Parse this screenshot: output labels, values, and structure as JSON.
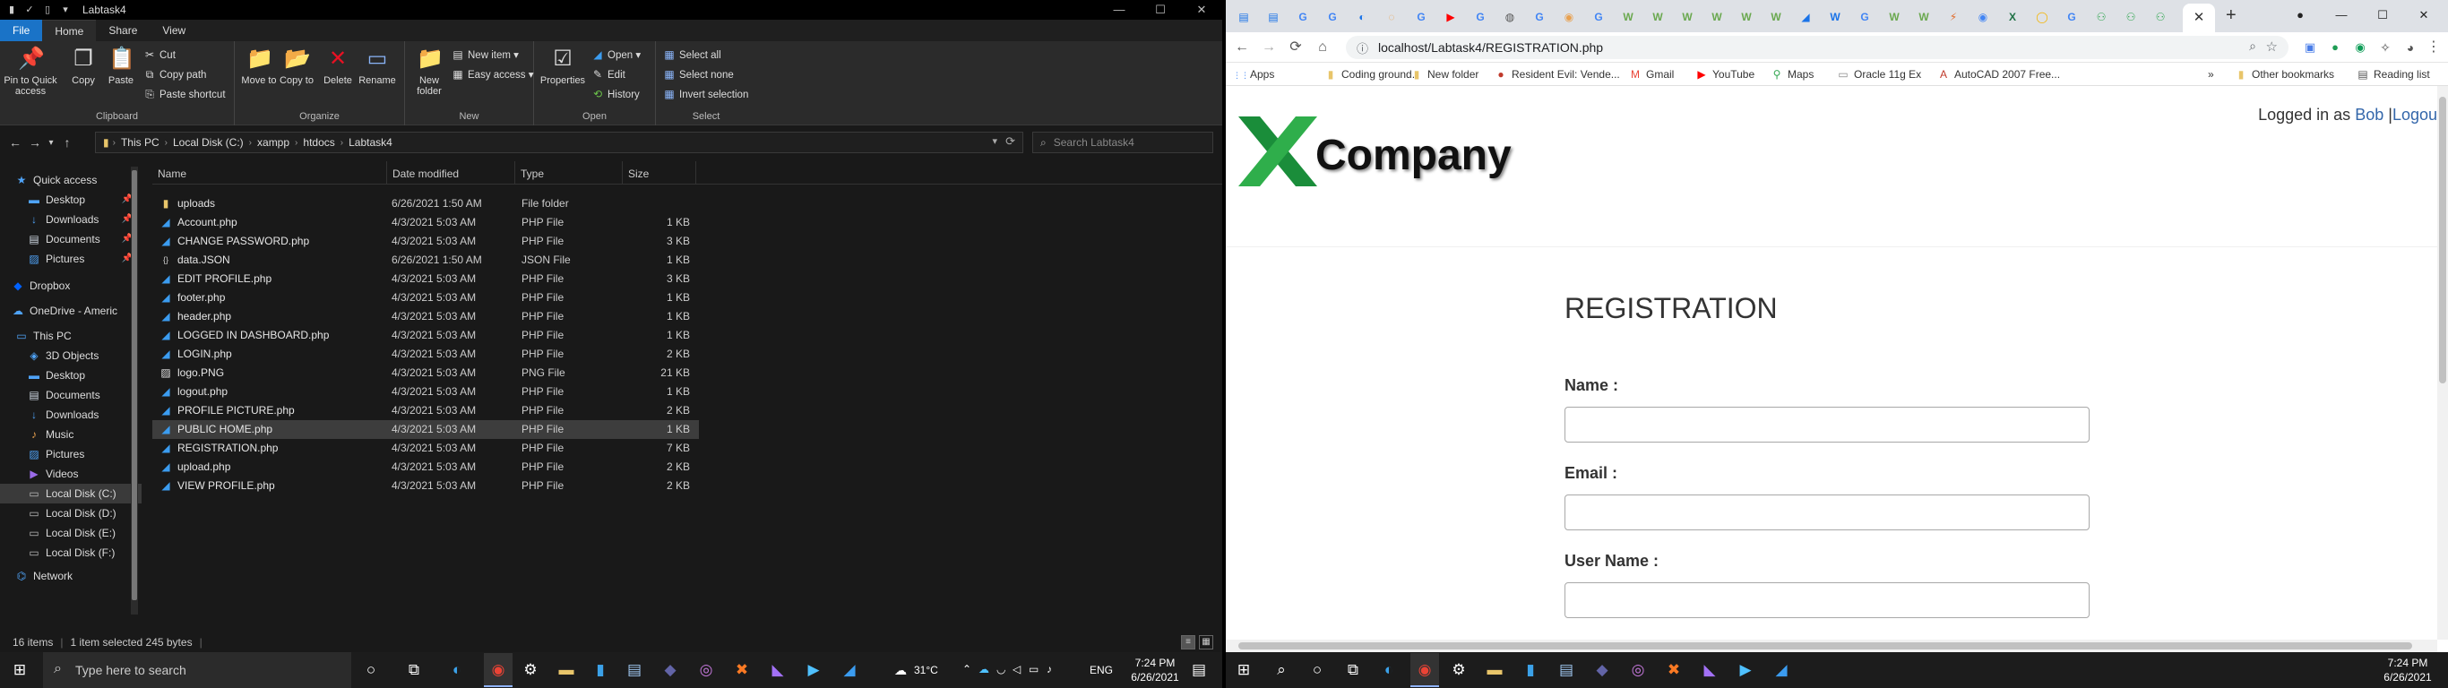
{
  "explorer": {
    "window_title": "Labtask4",
    "window_controls": [
      "—",
      "☐",
      "✕"
    ],
    "tabs": [
      {
        "label": "File"
      },
      {
        "label": "Home"
      },
      {
        "label": "Share"
      },
      {
        "label": "View"
      }
    ],
    "ribbon": {
      "clipboard": {
        "group_label": "Clipboard",
        "pin_label": "Pin to Quick access",
        "copy_label": "Copy",
        "paste_label": "Paste",
        "cut_label": "Cut",
        "copy_path_label": "Copy path",
        "paste_shortcut_label": "Paste shortcut"
      },
      "organize": {
        "group_label": "Organize",
        "move_to_label": "Move to",
        "copy_to_label": "Copy to",
        "delete_label": "Delete",
        "rename_label": "Rename"
      },
      "new": {
        "group_label": "New",
        "new_folder_label": "New folder",
        "new_item_label": "New item",
        "easy_access_label": "Easy access"
      },
      "open": {
        "group_label": "Open",
        "properties_label": "Properties",
        "open_label": "Open",
        "edit_label": "Edit",
        "history_label": "History"
      },
      "select": {
        "group_label": "Select",
        "select_all_label": "Select all",
        "select_none_label": "Select none",
        "invert_label": "Invert selection"
      }
    },
    "breadcrumb": [
      "This PC",
      "Local Disk (C:)",
      "xampp",
      "htdocs",
      "Labtask4"
    ],
    "search_placeholder": "Search Labtask4",
    "nav_items": [
      {
        "label": "Quick access",
        "icon": "star-icon",
        "pinned": false
      },
      {
        "label": "Desktop",
        "icon": "desktop-icon",
        "pinned": true
      },
      {
        "label": "Downloads",
        "icon": "download-icon",
        "pinned": true
      },
      {
        "label": "Documents",
        "icon": "document-icon",
        "pinned": true
      },
      {
        "label": "Pictures",
        "icon": "picture-icon",
        "pinned": true
      },
      {
        "label": "Dropbox",
        "icon": "dropbox-icon",
        "pinned": false
      },
      {
        "label": "OneDrive - Americ",
        "icon": "cloud-icon",
        "pinned": false
      },
      {
        "label": "This PC",
        "icon": "computer-icon",
        "pinned": false
      },
      {
        "label": "3D Objects",
        "icon": "cube-icon",
        "pinned": false
      },
      {
        "label": "Desktop",
        "icon": "desktop-icon",
        "pinned": false
      },
      {
        "label": "Documents",
        "icon": "document-icon",
        "pinned": false
      },
      {
        "label": "Downloads",
        "icon": "download-icon",
        "pinned": false
      },
      {
        "label": "Music",
        "icon": "music-icon",
        "pinned": false
      },
      {
        "label": "Pictures",
        "icon": "picture-icon",
        "pinned": false
      },
      {
        "label": "Videos",
        "icon": "video-icon",
        "pinned": false
      },
      {
        "label": "Local Disk (C:)",
        "icon": "drive-icon",
        "pinned": false
      },
      {
        "label": "Local Disk (D:)",
        "icon": "drive-icon",
        "pinned": false
      },
      {
        "label": "Local Disk (E:)",
        "icon": "drive-icon",
        "pinned": false
      },
      {
        "label": "Local Disk (F:)",
        "icon": "drive-icon",
        "pinned": false
      },
      {
        "label": "Network",
        "icon": "network-icon",
        "pinned": false
      }
    ],
    "columns": {
      "name": "Name",
      "date": "Date modified",
      "type": "Type",
      "size": "Size"
    },
    "files": [
      {
        "name": "uploads",
        "date": "6/26/2021 1:50 AM",
        "type": "File folder",
        "size": "",
        "icon": "folder-icon"
      },
      {
        "name": "Account.php",
        "date": "4/3/2021 5:03 AM",
        "type": "PHP File",
        "size": "1 KB",
        "icon": "vscode-file-icon"
      },
      {
        "name": "CHANGE PASSWORD.php",
        "date": "4/3/2021 5:03 AM",
        "type": "PHP File",
        "size": "3 KB",
        "icon": "vscode-file-icon"
      },
      {
        "name": "data.JSON",
        "date": "6/26/2021 1:50 AM",
        "type": "JSON File",
        "size": "1 KB",
        "icon": "json-file-icon"
      },
      {
        "name": "EDIT PROFILE.php",
        "date": "4/3/2021 5:03 AM",
        "type": "PHP File",
        "size": "3 KB",
        "icon": "vscode-file-icon"
      },
      {
        "name": "footer.php",
        "date": "4/3/2021 5:03 AM",
        "type": "PHP File",
        "size": "1 KB",
        "icon": "vscode-file-icon"
      },
      {
        "name": "header.php",
        "date": "4/3/2021 5:03 AM",
        "type": "PHP File",
        "size": "1 KB",
        "icon": "vscode-file-icon"
      },
      {
        "name": "LOGGED IN DASHBOARD.php",
        "date": "4/3/2021 5:03 AM",
        "type": "PHP File",
        "size": "1 KB",
        "icon": "vscode-file-icon"
      },
      {
        "name": "LOGIN.php",
        "date": "4/3/2021 5:03 AM",
        "type": "PHP File",
        "size": "2 KB",
        "icon": "vscode-file-icon"
      },
      {
        "name": "logo.PNG",
        "date": "4/3/2021 5:03 AM",
        "type": "PNG File",
        "size": "21 KB",
        "icon": "image-file-icon"
      },
      {
        "name": "logout.php",
        "date": "4/3/2021 5:03 AM",
        "type": "PHP File",
        "size": "1 KB",
        "icon": "vscode-file-icon"
      },
      {
        "name": "PROFILE PICTURE.php",
        "date": "4/3/2021 5:03 AM",
        "type": "PHP File",
        "size": "2 KB",
        "icon": "vscode-file-icon"
      },
      {
        "name": "PUBLIC HOME.php",
        "date": "4/3/2021 5:03 AM",
        "type": "PHP File",
        "size": "1 KB",
        "icon": "vscode-file-icon",
        "selected": true
      },
      {
        "name": "REGISTRATION.php",
        "date": "4/3/2021 5:03 AM",
        "type": "PHP File",
        "size": "7 KB",
        "icon": "vscode-file-icon"
      },
      {
        "name": "upload.php",
        "date": "4/3/2021 5:03 AM",
        "type": "PHP File",
        "size": "2 KB",
        "icon": "vscode-file-icon"
      },
      {
        "name": "VIEW PROFILE.php",
        "date": "4/3/2021 5:03 AM",
        "type": "PHP File",
        "size": "2 KB",
        "icon": "vscode-file-icon"
      }
    ],
    "status": {
      "items": "16 items",
      "selected": "1 item selected  245 bytes"
    }
  },
  "chrome": {
    "url": "localhost/Labtask4/REGISTRATION.php",
    "bookmarks": [
      {
        "label": "Apps",
        "icon": "apps-grid-icon"
      },
      {
        "label": "Coding ground.",
        "icon": "folder-icon"
      },
      {
        "label": "New folder",
        "icon": "folder-icon"
      },
      {
        "label": "Resident Evil: Vende...",
        "icon": "red-circle-icon"
      },
      {
        "label": "Gmail",
        "icon": "gmail-icon"
      },
      {
        "label": "YouTube",
        "icon": "youtube-icon"
      },
      {
        "label": "Maps",
        "icon": "maps-pin-icon"
      },
      {
        "label": "Oracle 11g Ex",
        "icon": "page-icon"
      },
      {
        "label": "AutoCAD 2007 Free...",
        "icon": "autocad-icon"
      }
    ],
    "other_bookmarks": "Other bookmarks",
    "reading_list": "Reading list",
    "window_controls": [
      "—",
      "☐",
      "✕"
    ]
  },
  "page": {
    "logo_text": "Company",
    "logged_in_prefix": "Logged in as",
    "user_name": "Bob",
    "logout_text": "Logou",
    "form_title": "REGISTRATION",
    "labels": {
      "name": "Name :",
      "email": "Email :",
      "username": "User Name :"
    }
  },
  "taskbar_left": {
    "search_placeholder": "Type here to search",
    "weather": "31°C",
    "lang": "ENG",
    "time": "7:24 PM",
    "date": "6/26/2021"
  },
  "taskbar_right": {
    "time": "7:24 PM",
    "date": "6/26/2021"
  }
}
